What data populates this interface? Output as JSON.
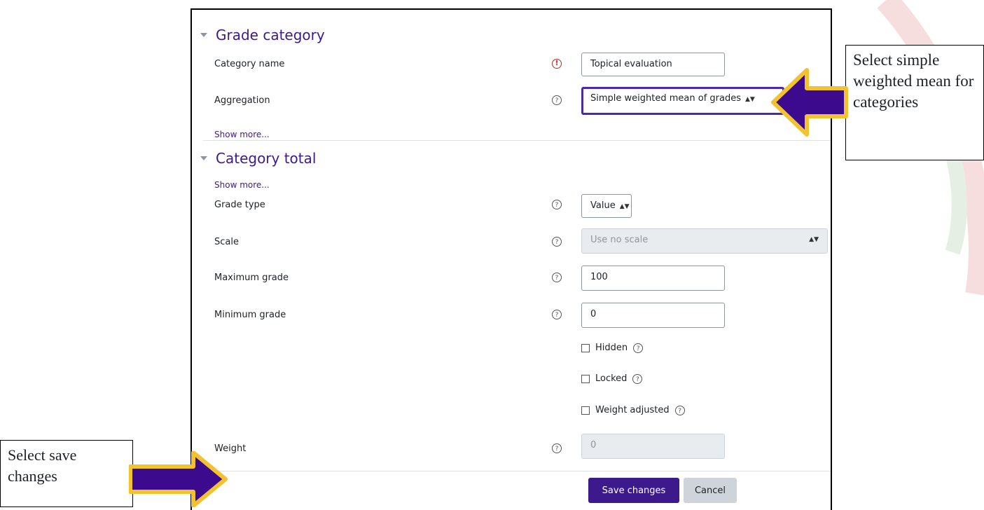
{
  "grade_category": {
    "title": "Grade category",
    "category_name_label": "Category name",
    "category_name_value": "Topical evaluation",
    "aggregation_label": "Aggregation",
    "aggregation_value": "Simple weighted mean of grades",
    "show_more": "Show more..."
  },
  "category_total": {
    "title": "Category total",
    "show_more": "Show more...",
    "grade_type_label": "Grade type",
    "grade_type_value": "Value",
    "scale_label": "Scale",
    "scale_value": "Use no scale",
    "max_grade_label": "Maximum grade",
    "max_grade_value": "100",
    "min_grade_label": "Minimum grade",
    "min_grade_value": "0",
    "hidden_label": "Hidden",
    "locked_label": "Locked",
    "weight_adjusted_label": "Weight adjusted",
    "weight_label": "Weight",
    "weight_value": "0"
  },
  "buttons": {
    "save": "Save changes",
    "cancel": "Cancel"
  },
  "annotations": {
    "aggregation_callout": "Select simple weighted mean for categories",
    "save_callout": "Select save changes"
  },
  "colors": {
    "accent": "#3c1a8c",
    "arrow_fill": "#3c0a8c",
    "arrow_outline": "#f2c230"
  }
}
